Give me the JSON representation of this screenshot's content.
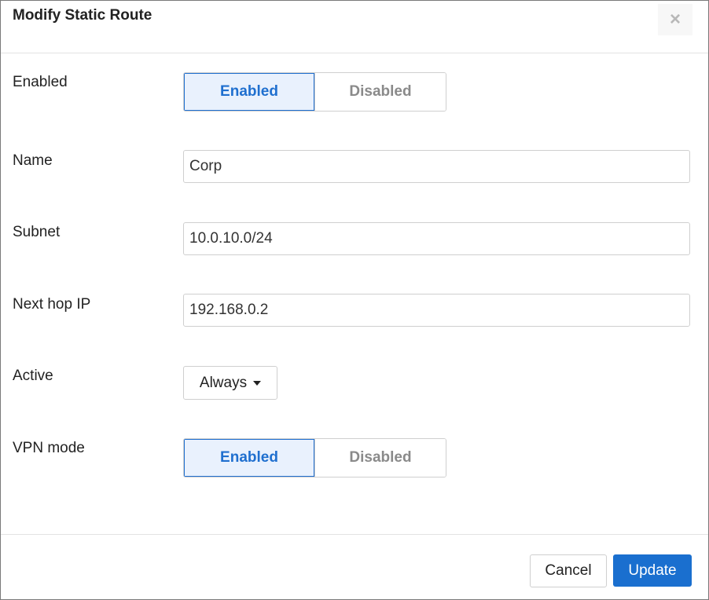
{
  "dialog": {
    "title": "Modify Static Route",
    "close_icon": "close-icon"
  },
  "fields": {
    "enabled": {
      "label": "Enabled",
      "options": [
        "Enabled",
        "Disabled"
      ],
      "selected": "Enabled"
    },
    "name": {
      "label": "Name",
      "value": "Corp"
    },
    "subnet": {
      "label": "Subnet",
      "value": "10.0.10.0/24"
    },
    "next_hop": {
      "label": "Next hop IP",
      "value": "192.168.0.2"
    },
    "active": {
      "label": "Active",
      "value": "Always"
    },
    "vpn_mode": {
      "label": "VPN mode",
      "options": [
        "Enabled",
        "Disabled"
      ],
      "selected": "Enabled"
    }
  },
  "footer": {
    "cancel_label": "Cancel",
    "update_label": "Update"
  },
  "colors": {
    "accent": "#1a6fcf",
    "active_toggle_bg": "#e9f1fd"
  }
}
